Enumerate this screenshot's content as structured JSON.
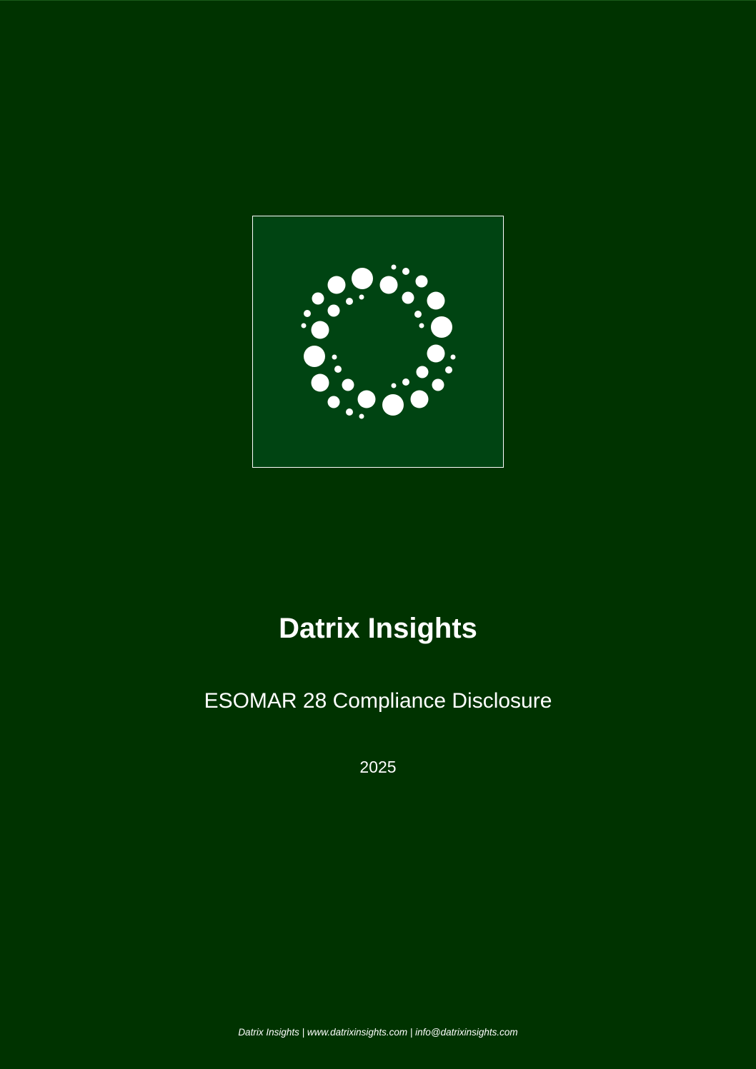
{
  "cover": {
    "company_name": "Datrix Insights",
    "document_title": "ESOMAR 28 Compliance Disclosure",
    "year": "2025"
  },
  "footer": {
    "text": "Datrix Insights | www.datrixinsights.com | info@datrixinsights.com"
  },
  "logo": {
    "icon": "dotted-ring-logo-icon",
    "dot_color": "#ffffff",
    "box_color": "#004412"
  },
  "colors": {
    "background": "#003300",
    "text": "#ffffff"
  }
}
